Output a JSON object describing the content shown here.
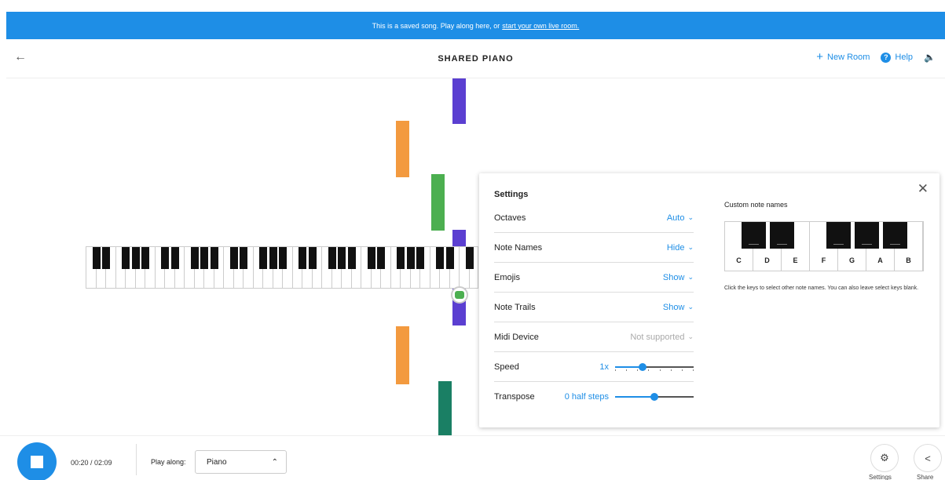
{
  "banner": {
    "text": "This is a saved song. Play along here, or",
    "link": "start your own live room."
  },
  "header": {
    "title": "SHARED PIANO",
    "new_room": "New Room",
    "help": "Help"
  },
  "colors": {
    "accent": "#1e8ee6",
    "purple": "#5b3fd1",
    "orange": "#f39a3f",
    "green": "#4caf50",
    "teal": "#1a7f64"
  },
  "settings": {
    "title": "Settings",
    "rows": [
      {
        "label": "Octaves",
        "value": "Auto"
      },
      {
        "label": "Note Names",
        "value": "Hide"
      },
      {
        "label": "Emojis",
        "value": "Show"
      },
      {
        "label": "Note Trails",
        "value": "Show"
      },
      {
        "label": "Midi Device",
        "value": "Not supported"
      }
    ],
    "speed": {
      "label": "Speed",
      "value": "1x",
      "level": 0.35
    },
    "transpose": {
      "label": "Transpose",
      "value": "0 half steps",
      "level": 0.5
    },
    "custom_note_names": {
      "title": "Custom note names",
      "keys": [
        "C",
        "D",
        "E",
        "F",
        "G",
        "A",
        "B"
      ],
      "help": "Click the keys to select other note names. You can also leave select keys blank."
    }
  },
  "player": {
    "time": "00:20 / 02:09",
    "play_along_label": "Play along:",
    "instrument": "Piano",
    "settings_label": "Settings",
    "share_label": "Share"
  }
}
